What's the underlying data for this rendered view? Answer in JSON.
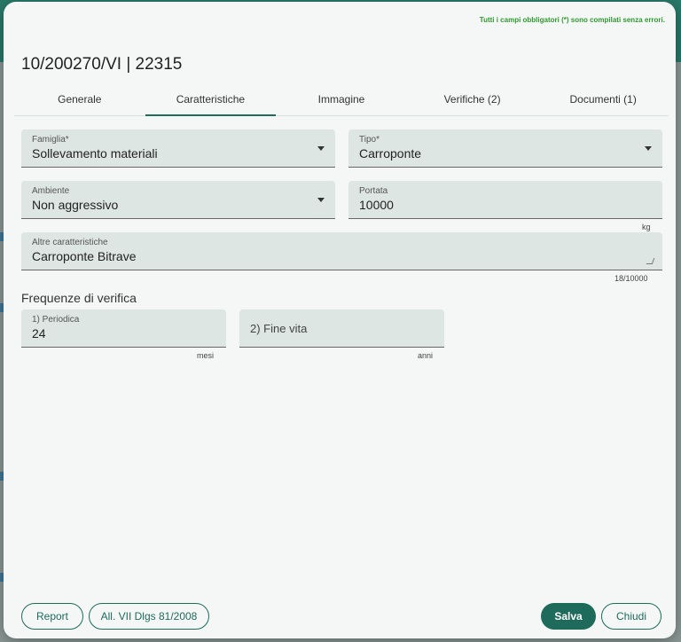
{
  "status_message": "Tutti i campi obbligatori (*) sono compilati senza errori.",
  "title": "10/200270/VI | 22315",
  "tabs": [
    {
      "label": "Generale"
    },
    {
      "label": "Caratteristiche"
    },
    {
      "label": "Immagine"
    },
    {
      "label": "Verifiche (2)"
    },
    {
      "label": "Documenti (1)"
    }
  ],
  "active_tab": "Caratteristiche",
  "form": {
    "famiglia": {
      "label": "Famiglia*",
      "value": "Sollevamento materiali"
    },
    "tipo": {
      "label": "Tipo*",
      "value": "Carroponte"
    },
    "ambiente": {
      "label": "Ambiente",
      "value": "Non aggressivo"
    },
    "portata": {
      "label": "Portata",
      "value": "10000",
      "suffix": "kg"
    },
    "altre": {
      "label": "Altre caratteristiche",
      "value": "Carroponte Bitrave",
      "counter": "18/10000"
    }
  },
  "frequenze": {
    "heading": "Frequenze di verifica",
    "periodica": {
      "label": "1) Periodica",
      "value": "24",
      "suffix": "mesi"
    },
    "fine_vita": {
      "placeholder": "2) Fine vita",
      "suffix": "anni"
    }
  },
  "buttons": {
    "report": "Report",
    "allegato": "All. VII Dlgs 81/2008",
    "salva": "Salva",
    "chiudi": "Chiudi"
  },
  "colors": {
    "primary": "#1e6b5c",
    "success": "#2e9a2e"
  }
}
